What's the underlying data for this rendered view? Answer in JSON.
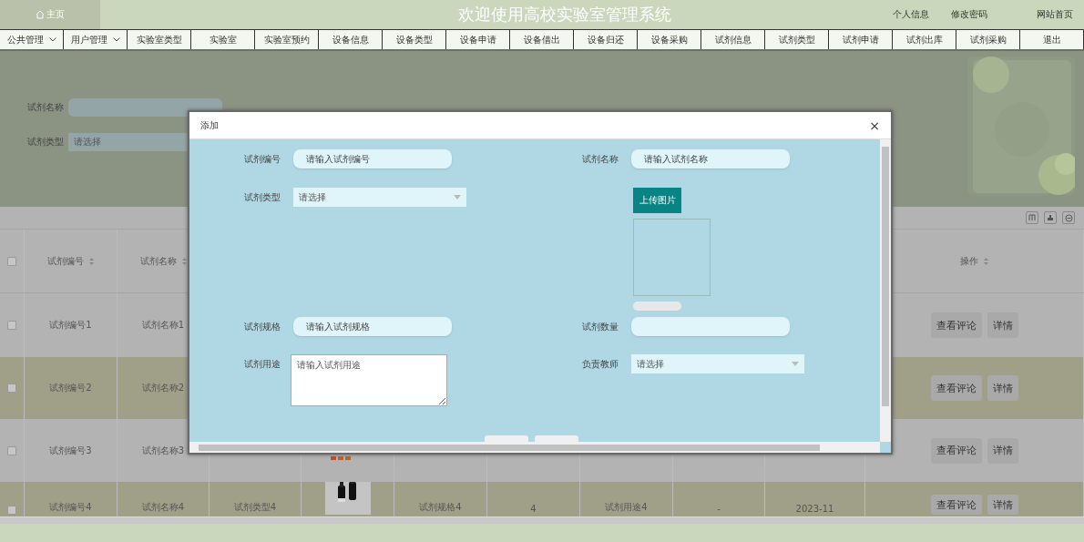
{
  "header": {
    "home": "主页",
    "title": "欢迎使用高校实验室管理系统",
    "links": [
      "个人信息",
      "修改密码",
      "网站首页"
    ]
  },
  "nav": [
    {
      "label": "公共管理",
      "dropdown": true
    },
    {
      "label": "用户管理",
      "dropdown": true
    },
    {
      "label": "实验室类型",
      "dropdown": false
    },
    {
      "label": "实验室",
      "dropdown": false
    },
    {
      "label": "实验室预约",
      "dropdown": false
    },
    {
      "label": "设备信息",
      "dropdown": false
    },
    {
      "label": "设备类型",
      "dropdown": false
    },
    {
      "label": "设备申请",
      "dropdown": false
    },
    {
      "label": "设备借出",
      "dropdown": false
    },
    {
      "label": "设备归还",
      "dropdown": false
    },
    {
      "label": "设备采购",
      "dropdown": false
    },
    {
      "label": "试剂信息",
      "dropdown": false
    },
    {
      "label": "试剂类型",
      "dropdown": false
    },
    {
      "label": "试剂申请",
      "dropdown": false
    },
    {
      "label": "试剂出库",
      "dropdown": false
    },
    {
      "label": "试剂采购",
      "dropdown": false
    },
    {
      "label": "退出",
      "dropdown": false
    }
  ],
  "search": {
    "fields": [
      {
        "label": "试剂名称",
        "kind": "input"
      },
      {
        "label": "试剂类型",
        "kind": "select",
        "placeholder": "请选择"
      }
    ]
  },
  "table": {
    "all_checked": false,
    "columns": [
      "试剂编号",
      "试剂名称",
      null,
      null,
      null,
      null,
      null,
      null,
      null,
      "操作"
    ],
    "rows": [
      {
        "checked": false,
        "cells": [
          {
            "kind": "text",
            "text": "试剂编号1"
          },
          {
            "kind": "text",
            "text": "试剂名称1"
          }
        ],
        "actions": [
          "查看评论",
          "详情"
        ]
      },
      {
        "checked": false,
        "cells": [
          {
            "kind": "text",
            "text": "试剂编号2"
          },
          {
            "kind": "text",
            "text": "试剂名称2"
          }
        ],
        "actions": [
          "查看评论",
          "详情"
        ]
      },
      {
        "checked": false,
        "cells": [
          {
            "kind": "text",
            "text": "试剂编号3"
          },
          {
            "kind": "text",
            "text": "试剂名称3"
          },
          null,
          {
            "kind": "picture"
          }
        ],
        "actions": [
          "查看评论",
          "详情"
        ]
      },
      {
        "checked": false,
        "cells": [
          {
            "kind": "text",
            "text": "试剂编号4"
          },
          {
            "kind": "text",
            "text": "试剂名称4"
          },
          {
            "kind": "text",
            "text": "试剂类型4"
          },
          {
            "kind": "picture"
          },
          {
            "kind": "text",
            "text": "试剂规格4"
          },
          {
            "kind": "text",
            "text": "4"
          },
          {
            "kind": "text",
            "text": "试剂用途4"
          },
          {
            "kind": "text",
            "text": "-"
          },
          {
            "kind": "text",
            "text": "2023-11"
          }
        ],
        "actions": [
          "查看评论",
          "详情"
        ]
      }
    ]
  },
  "modal": {
    "title": "添加",
    "close": "×",
    "fields": [
      {
        "kind": "input",
        "label": "试剂编号",
        "placeholder": "请输入试剂编号"
      },
      {
        "kind": "input",
        "label": "试剂名称",
        "placeholder": "请输入试剂名称"
      },
      {
        "kind": "select",
        "label": "试剂类型",
        "placeholder": "请选择"
      },
      {
        "kind": "upload",
        "button": "上传图片"
      },
      {
        "kind": "input",
        "label": "试剂规格",
        "placeholder": "请输入试剂规格"
      },
      {
        "kind": "input",
        "label": "试剂数量"
      },
      {
        "kind": "textarea",
        "label": "试剂用途",
        "placeholder": "请输入试剂用途"
      },
      {
        "kind": "select",
        "label": "负责教师",
        "placeholder": "请选择"
      }
    ]
  }
}
